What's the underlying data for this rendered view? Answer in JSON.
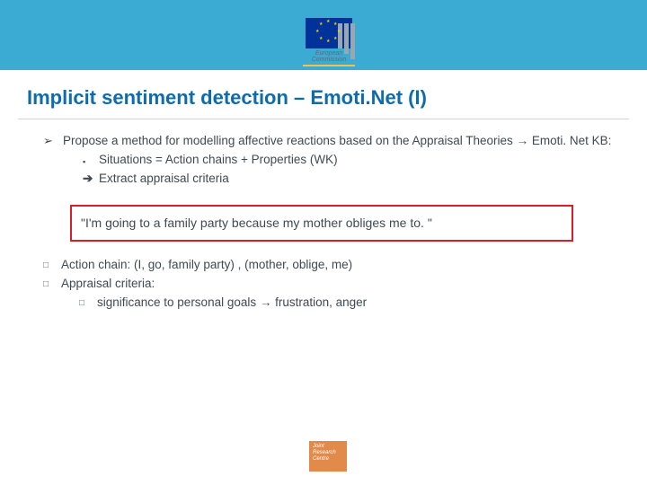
{
  "header": {
    "logo_label_line1": "European",
    "logo_label_line2": "Commission"
  },
  "title": "Implicit sentiment detection – Emoti.Net (I)",
  "bullets": {
    "main_part1": "Propose a method for modelling affective reactions based on the Appraisal Theories ",
    "main_arrow": "→",
    "main_part2": " Emoti. Net KB:",
    "sub_situations": "Situations = Action chains + Properties (WK)",
    "sub_extract": "Extract appraisal criteria"
  },
  "quote": "\"I'm going to a family party because my mother obliges me to. \"",
  "lower": {
    "action_chain": "Action chain: (I, go, family party) , (mother, oblige, me)",
    "appraisal_label": " Appraisal criteria:",
    "appraisal_sub_part1": "significance to personal goals ",
    "appraisal_sub_arrow": "→",
    "appraisal_sub_part2": " frustration, anger"
  },
  "footer": {
    "line1": "Joint",
    "line2": "Research",
    "line3": "Centre"
  }
}
